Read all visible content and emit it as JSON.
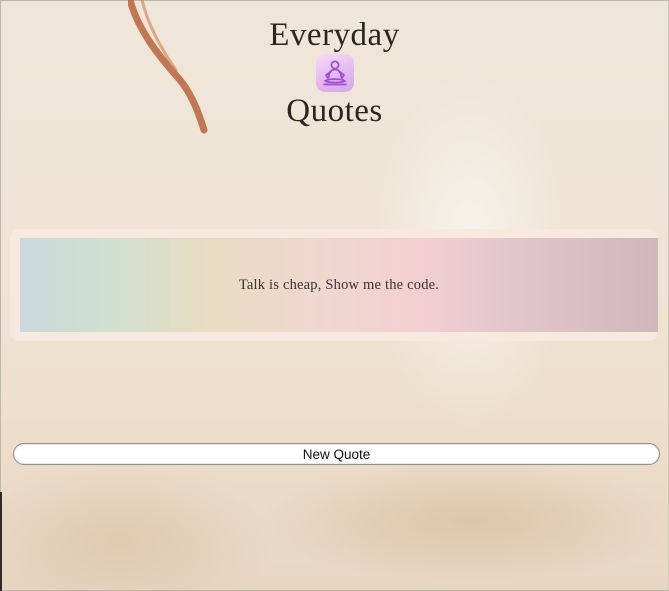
{
  "header": {
    "title_line1": "Everyday",
    "title_line2": "Quotes",
    "logo_icon": "meditating-person-icon",
    "logo_color": "#9b4fd8"
  },
  "quote": {
    "text": "Talk is cheap, Show me the code."
  },
  "actions": {
    "new_quote_label": "New Quote"
  },
  "colors": {
    "card_border": "#f7e9de",
    "text_dark": "#2a2623"
  }
}
